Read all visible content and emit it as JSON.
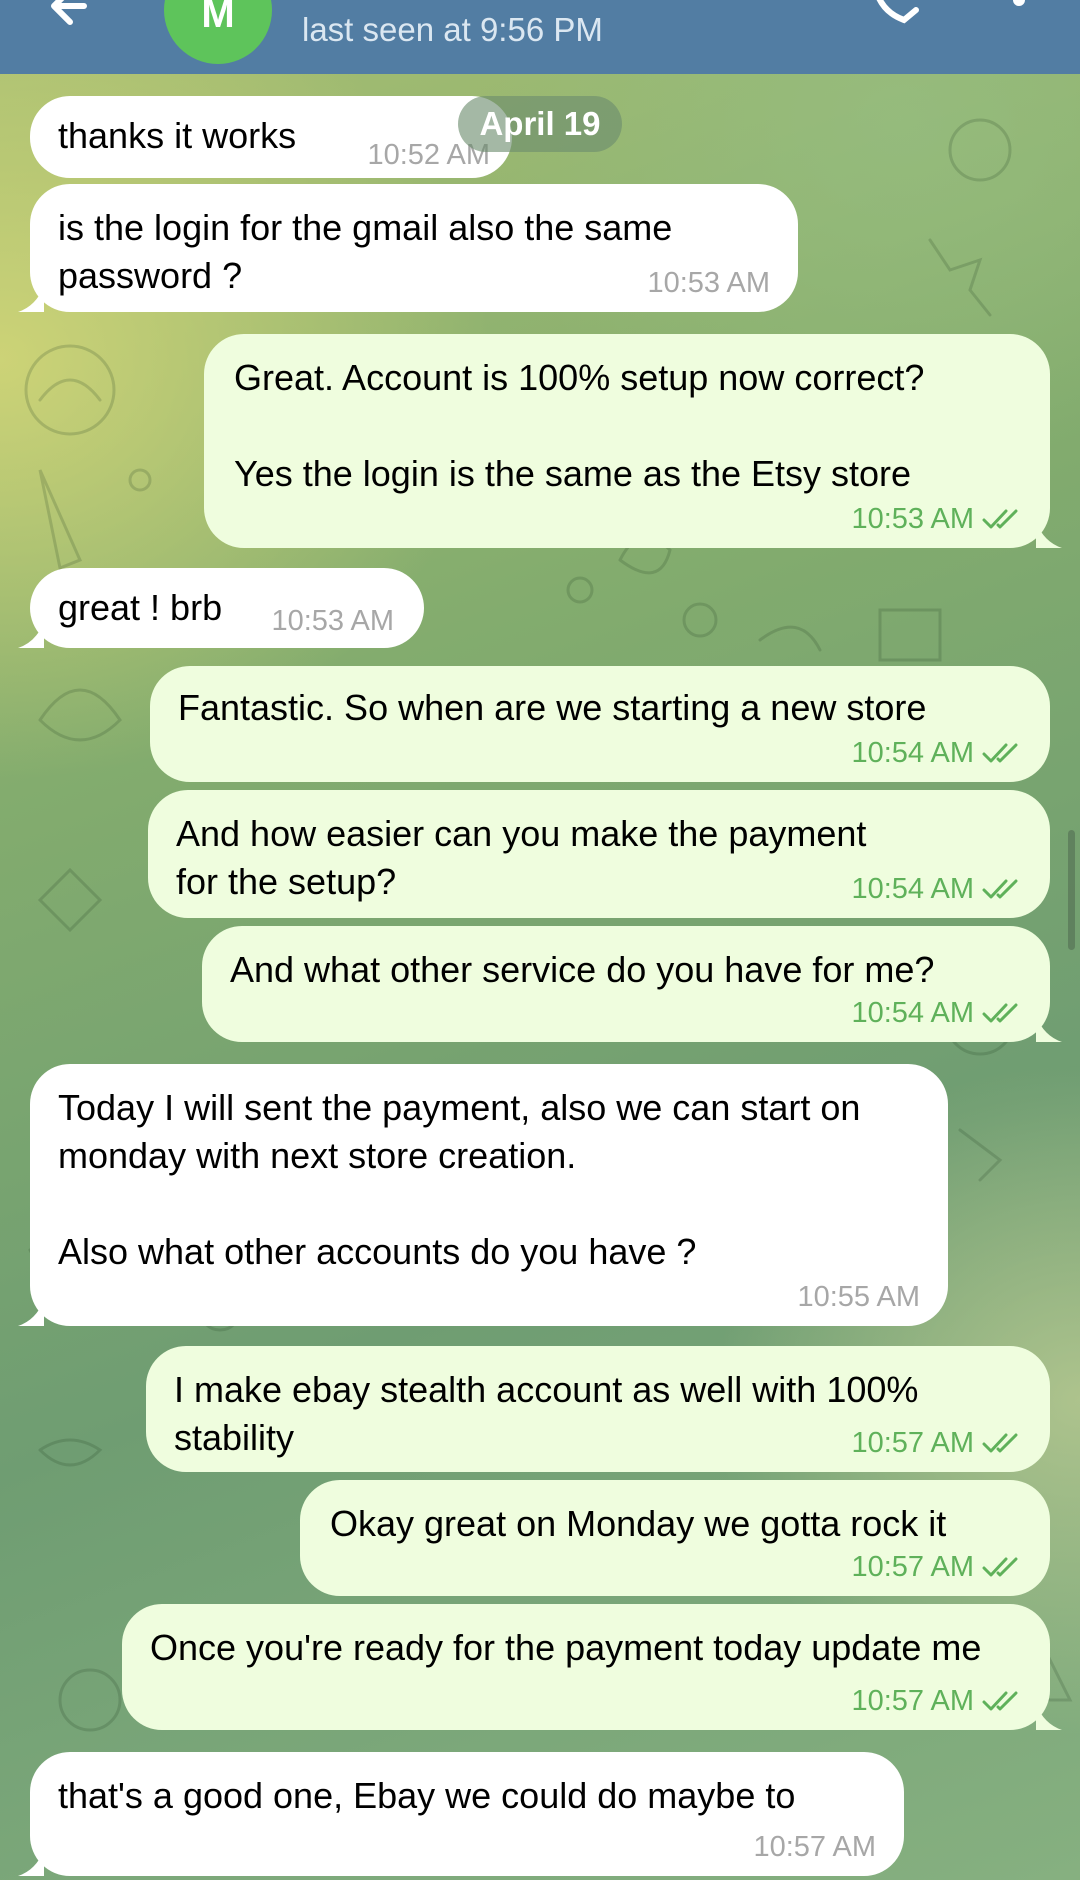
{
  "header": {
    "avatar_initial": "M",
    "status": "last seen at 9:56 PM"
  },
  "date_separator": "April 19",
  "messages": [
    {
      "side": "in",
      "text": "thanks it works",
      "time": "10:52 AM"
    },
    {
      "side": "in",
      "text": "is the login for the gmail also the same password ?",
      "time": "10:53 AM"
    },
    {
      "side": "out",
      "text": "Great. Account is 100% setup now correct?\n\nYes the login is the same as the Etsy store",
      "time": "10:53 AM",
      "read": true
    },
    {
      "side": "in",
      "text": "great ! brb",
      "time": "10:53 AM"
    },
    {
      "side": "out",
      "text": "Fantastic. So when are we starting a new store",
      "time": "10:54 AM",
      "read": true
    },
    {
      "side": "out",
      "text": "And how easier can you make the payment for the setup?",
      "time": "10:54 AM",
      "read": true
    },
    {
      "side": "out",
      "text": "And what other service do you have for me?",
      "time": "10:54 AM",
      "read": true
    },
    {
      "side": "in",
      "text": "Today I will sent the payment, also we can start on monday with next store creation.\n\nAlso what other accounts do you have ?",
      "time": "10:55 AM"
    },
    {
      "side": "out",
      "text": "I make ebay stealth account as well with 100% stability",
      "time": "10:57 AM",
      "read": true
    },
    {
      "side": "out",
      "text": "Okay great on Monday we gotta rock it",
      "time": "10:57 AM",
      "read": true
    },
    {
      "side": "out",
      "text": "Once you're ready for the payment today update me",
      "time": "10:57 AM",
      "read": true
    },
    {
      "side": "in",
      "text": "that's a good one, Ebay we could do maybe to",
      "time": "10:57 AM"
    }
  ],
  "colors": {
    "header": "#527da3",
    "incoming_bubble": "#ffffff",
    "outgoing_bubble": "#effdde",
    "outgoing_meta": "#5fb15a",
    "incoming_meta": "#a7a7a7",
    "avatar": "#5ec45b"
  },
  "icons": [
    "back-arrow-icon",
    "phone-icon",
    "more-vertical-icon",
    "double-check-icon"
  ]
}
